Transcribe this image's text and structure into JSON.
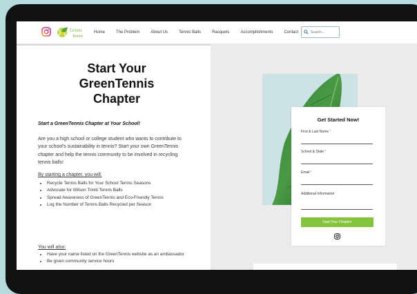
{
  "header": {
    "logo_text": "GreenTennis",
    "nav": [
      "Home",
      "The Problem",
      "About Us",
      "Tennis Balls",
      "Racquets",
      "Accomplishments",
      "Contact"
    ],
    "search_placeholder": "Search..."
  },
  "main": {
    "title_lines": [
      "Start Your",
      "GreenTennis",
      "Chapter"
    ],
    "subtitle": "Start a GreenTennis Chapter at Your School!",
    "intro": "Are you a high school or college student who wants to contribute to your school's sustainability in tennis? Start your own GreenTennis chapter and help the tennis community to be involved in recycling tennis balls!",
    "chapter_heading": "By starting a chapter, you will:",
    "chapter_items": [
      "Recycle Tennis Balls for Your School Tennis Seasons",
      "Advocate for Wilson Triniti Tennis Balls",
      "Spread Awareness of GreenTennis and Eco-Friendly Tennis",
      "Log the Number of Tennis Balls Recycled per Season"
    ],
    "also_heading": "You will also:",
    "also_items": [
      "Have your name listed on the GreenTennis website as an ambassador",
      "Be given community service hours"
    ]
  },
  "form": {
    "title": "Get Started Now!",
    "fields": [
      {
        "label": "First & Last Name",
        "required": "*"
      },
      {
        "label": "School & State",
        "required": "*"
      },
      {
        "label": "Email",
        "required": "*"
      },
      {
        "label": "Additional Information",
        "required": ""
      }
    ],
    "submit_label": "Start Your Chapter!"
  },
  "colors": {
    "button": "#84c43c",
    "outer_background": "#b8dbe0",
    "right_panel": "#ebebeb"
  }
}
